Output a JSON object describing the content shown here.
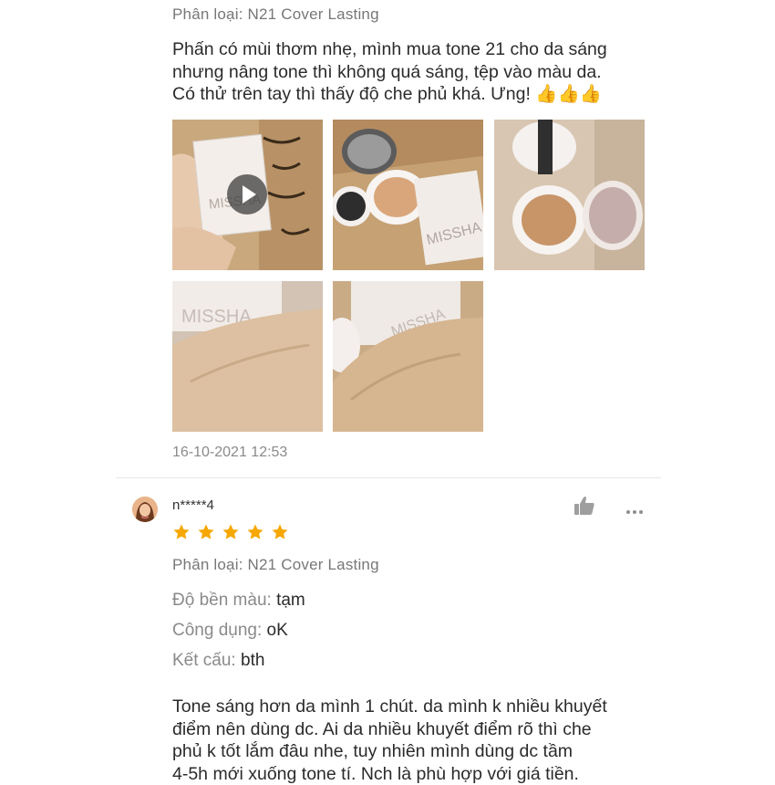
{
  "review1": {
    "variant": "Phân loại: N21 Cover Lasting",
    "text_lines": [
      "Phấn có mùi thơm nhẹ, mình mua tone 21 cho da sáng",
      "nhưng nâng tone thì không quá sáng, tệp vào màu da.",
      "Có thử trên tay thì thấy độ che phủ khá. Ưng! 👍👍👍"
    ],
    "timestamp": "16-10-2021 12:53"
  },
  "review2": {
    "username": "n*****4",
    "rating": 5,
    "variant": "Phân loại: N21 Cover Lasting",
    "attributes": [
      {
        "label": "Độ bền màu: ",
        "value": "tạm"
      },
      {
        "label": "Công dụng: ",
        "value": "oK"
      },
      {
        "label": "Kết cấu: ",
        "value": "bth"
      }
    ],
    "text_lines": [
      "Tone sáng hơn da mình 1 chút. da mình k nhiều khuyết",
      "điểm nên dùng dc. Ai da nhiều khuyết điểm rõ thì che",
      "phủ k tốt lắm đâu nhe, tuy nhiên mình dùng dc tầm",
      "4-5h mới xuống tone tí. Nch là phù hợp với giá tiền."
    ]
  },
  "product_text": {
    "brand": "MISSHA"
  },
  "colors": {
    "star": "#f6a700",
    "muted_text": "#8a8a8a",
    "divider": "#e6e6e6"
  },
  "icons": {
    "like": "thumbs-up-icon",
    "more": "more-dots-icon",
    "play": "play-icon",
    "star": "star-icon"
  }
}
